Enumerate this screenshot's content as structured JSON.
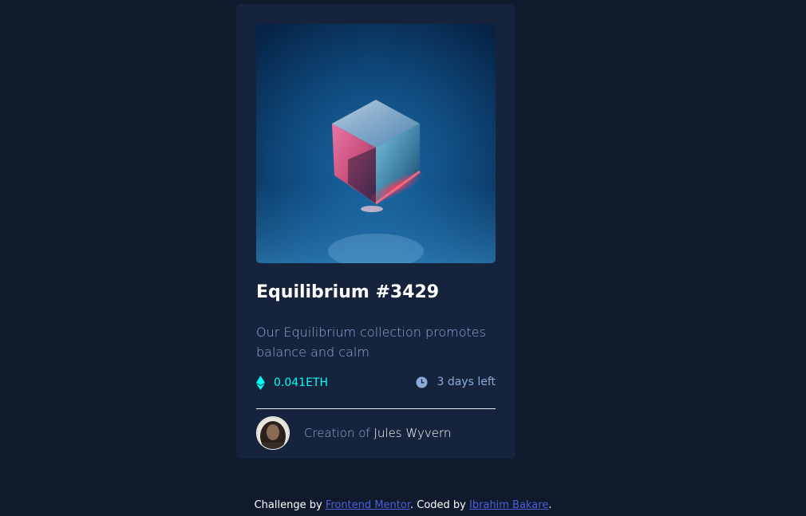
{
  "card": {
    "image_alt": "equilibrium",
    "title": "Equilibrium #3429",
    "description": "Our Equilibrium collection promotes balance and calm",
    "price": "0.041ETH",
    "time_left": "3 days left",
    "creator_prefix": "Creation of",
    "creator_name": "Jules Wyvern"
  },
  "attribution": {
    "prefix": "Challenge by",
    "challenge_link": "Frontend Mentor",
    "middle": ". Coded by",
    "author_link": "Ibrahim Bakare",
    "suffix": "."
  },
  "colors": {
    "page_bg": "#0f1a2c",
    "card_bg": "#15243c",
    "accent_cyan": "#00fff8",
    "soft_blue": "#8bacd9",
    "link": "#4e5fd9"
  },
  "icons": {
    "price": "ethereum-icon",
    "time": "clock-icon"
  }
}
